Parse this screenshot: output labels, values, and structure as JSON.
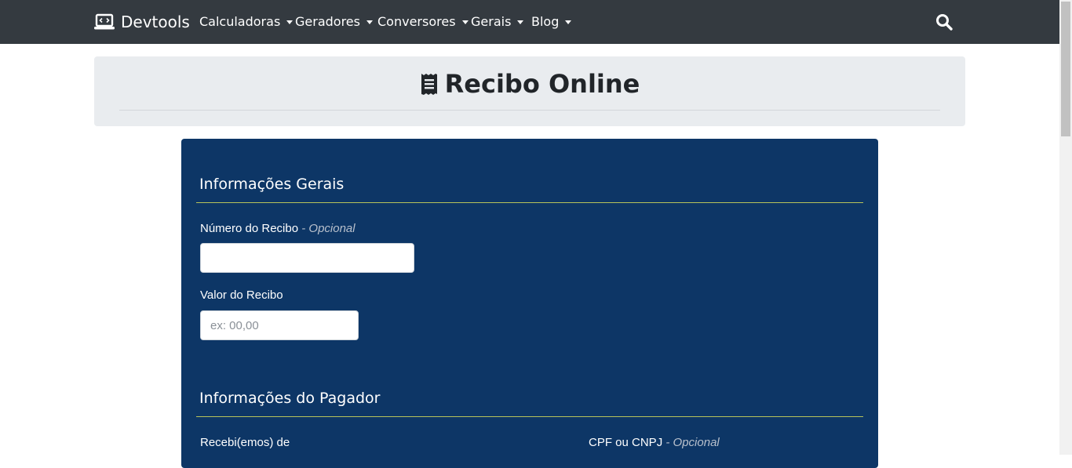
{
  "nav": {
    "brand": "Devtools",
    "items": [
      {
        "label": "Calculadoras"
      },
      {
        "label": "Geradores"
      },
      {
        "label": "Conversores"
      },
      {
        "label": "Gerais"
      },
      {
        "label": "Blog"
      }
    ],
    "icons": {
      "brand": "laptop-code-icon",
      "search": "search-icon"
    }
  },
  "header": {
    "title": "Recibo Online",
    "icon": "receipt-icon"
  },
  "form": {
    "general": {
      "title": "Informações Gerais",
      "receipt_number_label": "Número do Recibo",
      "receipt_number_optional": "- Opcional",
      "receipt_number_value": "",
      "receipt_value_label": "Valor do Recibo",
      "receipt_value_placeholder": "ex: 00,00"
    },
    "payer": {
      "title": "Informações do Pagador",
      "received_from_label": "Recebi(emos) de",
      "document_label": "CPF ou CNPJ",
      "document_optional": "- Opcional"
    }
  },
  "colors": {
    "navbar": "#343a40",
    "jumbotron": "#e9ecef",
    "card": "#0d3666",
    "section_rule": "#b7c35a"
  }
}
